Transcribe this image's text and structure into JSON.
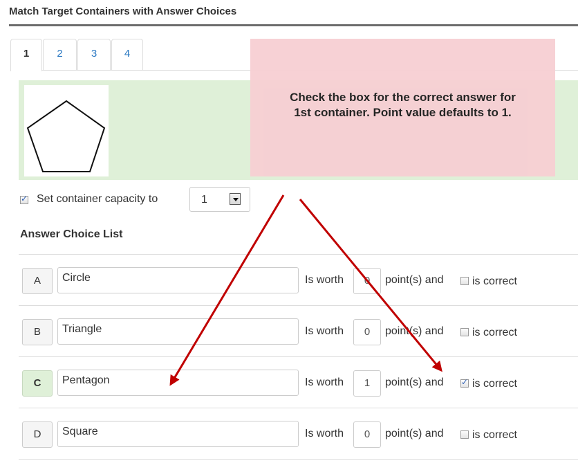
{
  "page": {
    "heading": "Match Target Containers with Answer Choices"
  },
  "tabs": [
    {
      "label": "1",
      "active": true
    },
    {
      "label": "2",
      "active": false
    },
    {
      "label": "3",
      "active": false
    },
    {
      "label": "4",
      "active": false
    }
  ],
  "target": {
    "shape_icon": "pentagon-icon"
  },
  "capacity": {
    "checked": true,
    "label": "Set container capacity to",
    "value": "1"
  },
  "answer_list": {
    "title": "Answer Choice List",
    "worth_label": "Is worth",
    "points_label": "point(s) and",
    "correct_label": "is correct",
    "items": [
      {
        "letter": "A",
        "text": "Circle",
        "points": "0",
        "is_correct": false
      },
      {
        "letter": "B",
        "text": "Triangle",
        "points": "0",
        "is_correct": false
      },
      {
        "letter": "C",
        "text": "Pentagon",
        "points": "1",
        "is_correct": true
      },
      {
        "letter": "D",
        "text": "Square",
        "points": "0",
        "is_correct": false
      }
    ]
  },
  "callout": {
    "line1": "Check the box for the correct answer for",
    "line2": "1st container. Point value defaults to 1."
  },
  "colors": {
    "arrow": "#c00000",
    "callout_bg": "#f7cfd3",
    "panel_green": "#dff0d8",
    "tab_link": "#2a78c2"
  }
}
